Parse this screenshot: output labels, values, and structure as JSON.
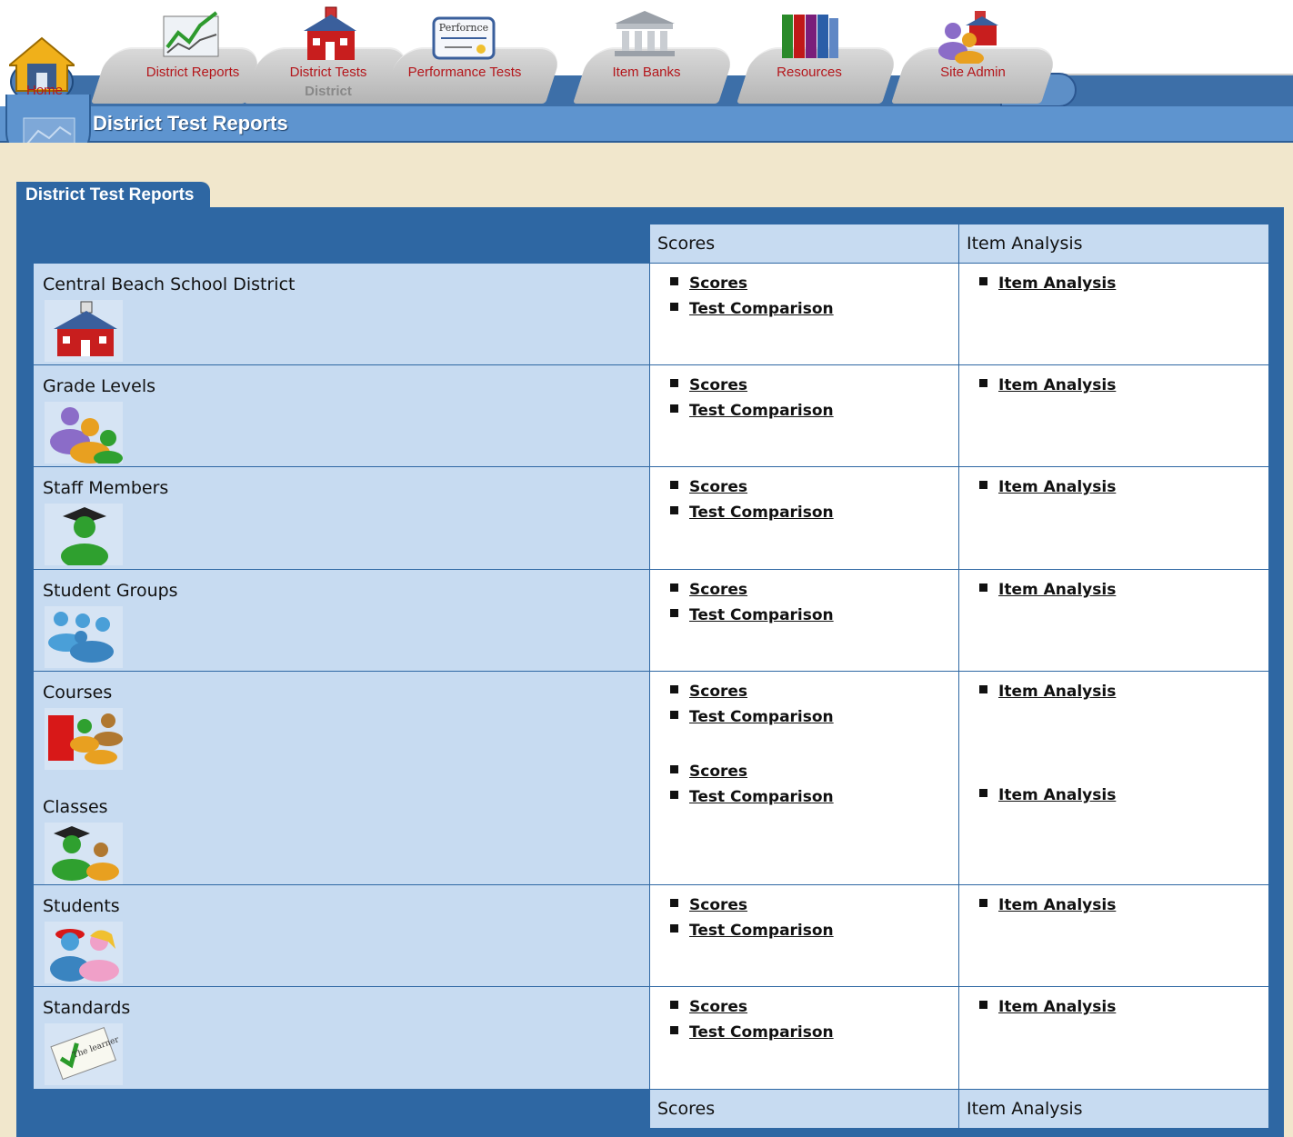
{
  "nav": {
    "home_label": "Home",
    "tabs": [
      {
        "label": "District Reports"
      },
      {
        "label": "District Tests",
        "sub": "District"
      },
      {
        "label": "Performance Tests"
      },
      {
        "label": "Item Banks"
      },
      {
        "label": "Resources"
      },
      {
        "label": "Site Admin"
      }
    ],
    "performance_icon_text": "Perfornce"
  },
  "page_title": "District Test Reports",
  "section_tab": "District Test Reports",
  "columns": {
    "scores": "Scores",
    "item_analysis": "Item Analysis"
  },
  "link_labels": {
    "scores": "Scores",
    "test_comparison": "Test Comparison",
    "item_analysis": "Item Analysis"
  },
  "rows": [
    {
      "name": "Central Beach School District",
      "icon": "school-house-icon"
    },
    {
      "name": "Grade Levels",
      "icon": "people-group-icon"
    },
    {
      "name": "Staff Members",
      "icon": "graduate-person-icon"
    },
    {
      "name": "Student Groups",
      "icon": "blue-people-group-icon"
    },
    {
      "name": "Courses",
      "icon": "book-people-icon"
    },
    {
      "name": "Classes",
      "icon": "graduate-group-icon"
    },
    {
      "name": "Students",
      "icon": "students-icon"
    },
    {
      "name": "Standards",
      "icon": "standards-checklist-icon"
    }
  ],
  "standards_icon_text": "The learner"
}
